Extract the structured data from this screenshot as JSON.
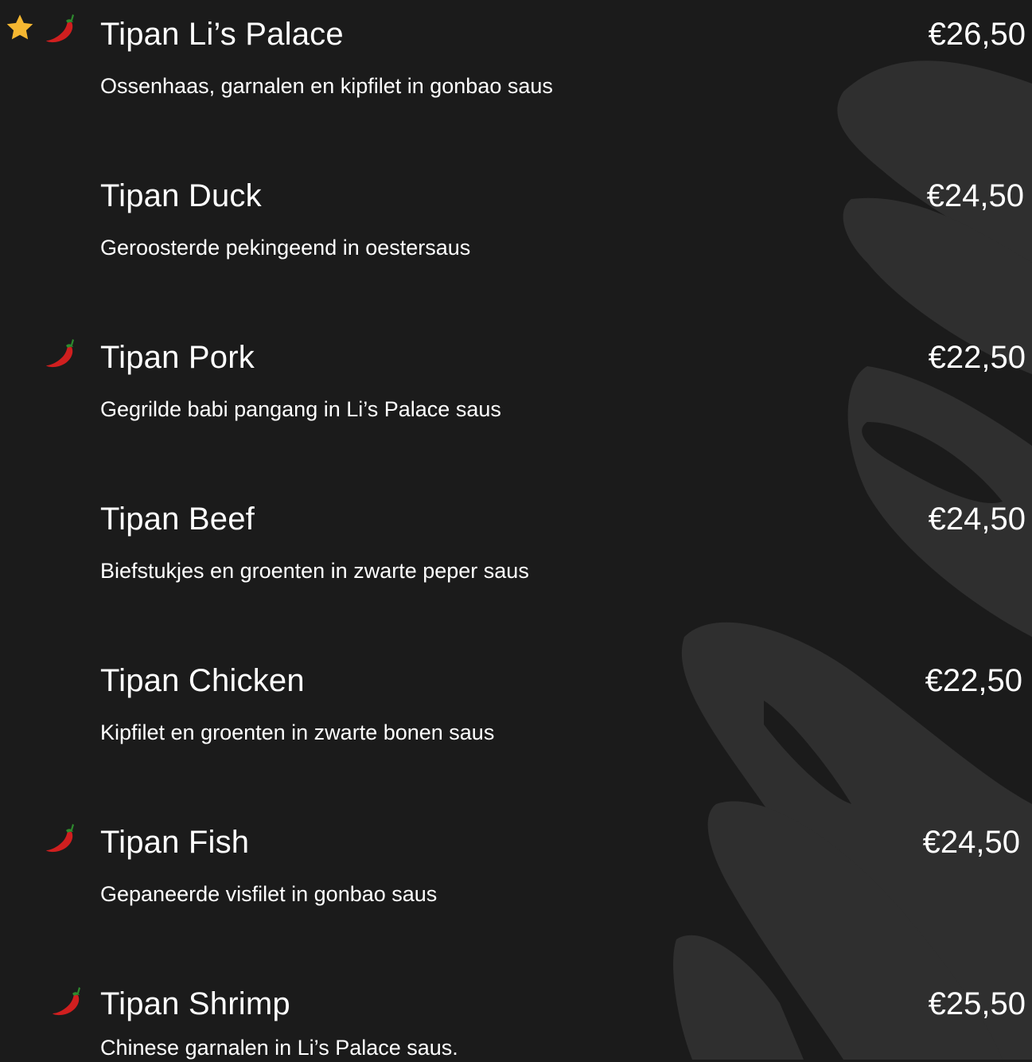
{
  "menu": {
    "items": [
      {
        "name": "Tipan Li’s Palace",
        "description": "Ossenhaas, garnalen en kipfilet in gonbao saus",
        "price": "€26,50",
        "icons": [
          "star-icon",
          "chili-pepper-icon"
        ]
      },
      {
        "name": "Tipan Duck",
        "description": "Geroosterde pekingeend in oestersaus",
        "price": "€24,50",
        "icons": []
      },
      {
        "name": "Tipan Pork",
        "description": "Gegrilde babi pangang in Li’s Palace saus",
        "price": "€22,50",
        "icons": [
          "chili-pepper-icon"
        ]
      },
      {
        "name": "Tipan Beef",
        "description": "Biefstukjes en groenten in zwarte peper saus",
        "price": "€24,50",
        "icons": []
      },
      {
        "name": "Tipan Chicken",
        "description": "Kipfilet en groenten in zwarte bonen saus",
        "price": "€22,50",
        "icons": []
      },
      {
        "name": "Tipan Fish",
        "description": "Gepaneerde visfilet in gonbao saus",
        "price": "€24,50",
        "icons": [
          "chili-pepper-icon"
        ]
      },
      {
        "name": "Tipan Shrimp",
        "description": "Chinese garnalen in Li’s Palace saus.",
        "price": "€25,50",
        "icons": [
          "chili-pepper-icon"
        ]
      }
    ]
  },
  "colors": {
    "background": "#1b1b1b",
    "brush": "#2f2f2f",
    "text": "#ffffff",
    "star": "#f5b731",
    "chili": "#d01f1f"
  }
}
